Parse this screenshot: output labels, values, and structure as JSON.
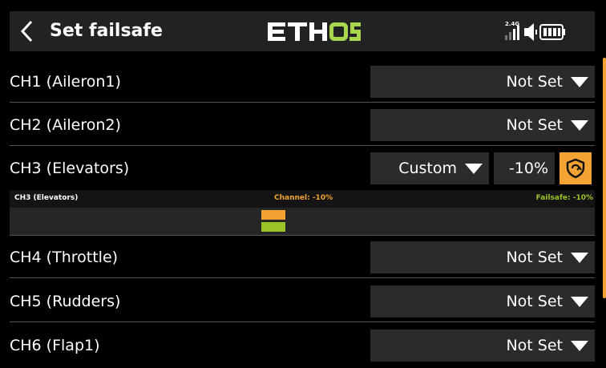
{
  "header": {
    "title": "Set failsafe",
    "logo_text": "ETHOS",
    "signal_label": "2.4G"
  },
  "colors": {
    "accent": "#f3a333",
    "failsafe_green": "#9ac428",
    "panel": "#2b2b2b",
    "header_bg": "#222222"
  },
  "channels": [
    {
      "label": "CH1 (Aileron1)",
      "mode": "Not Set"
    },
    {
      "label": "CH2 (Aileron2)",
      "mode": "Not Set"
    },
    {
      "label": "CH3 (Elevators)",
      "mode": "Custom",
      "value": "-10%"
    },
    {
      "label": "CH4 (Throttle)",
      "mode": "Not Set"
    },
    {
      "label": "CH5 (Rudders)",
      "mode": "Not Set"
    },
    {
      "label": "CH6 (Flap1)",
      "mode": "Not Set"
    }
  ],
  "detail": {
    "channel_name": "CH3 (Elevators)",
    "channel_text": "Channel: -10%",
    "failsafe_text": "Failsafe: -10%",
    "channel_value_percent": -10,
    "failsafe_value_percent": -10
  }
}
